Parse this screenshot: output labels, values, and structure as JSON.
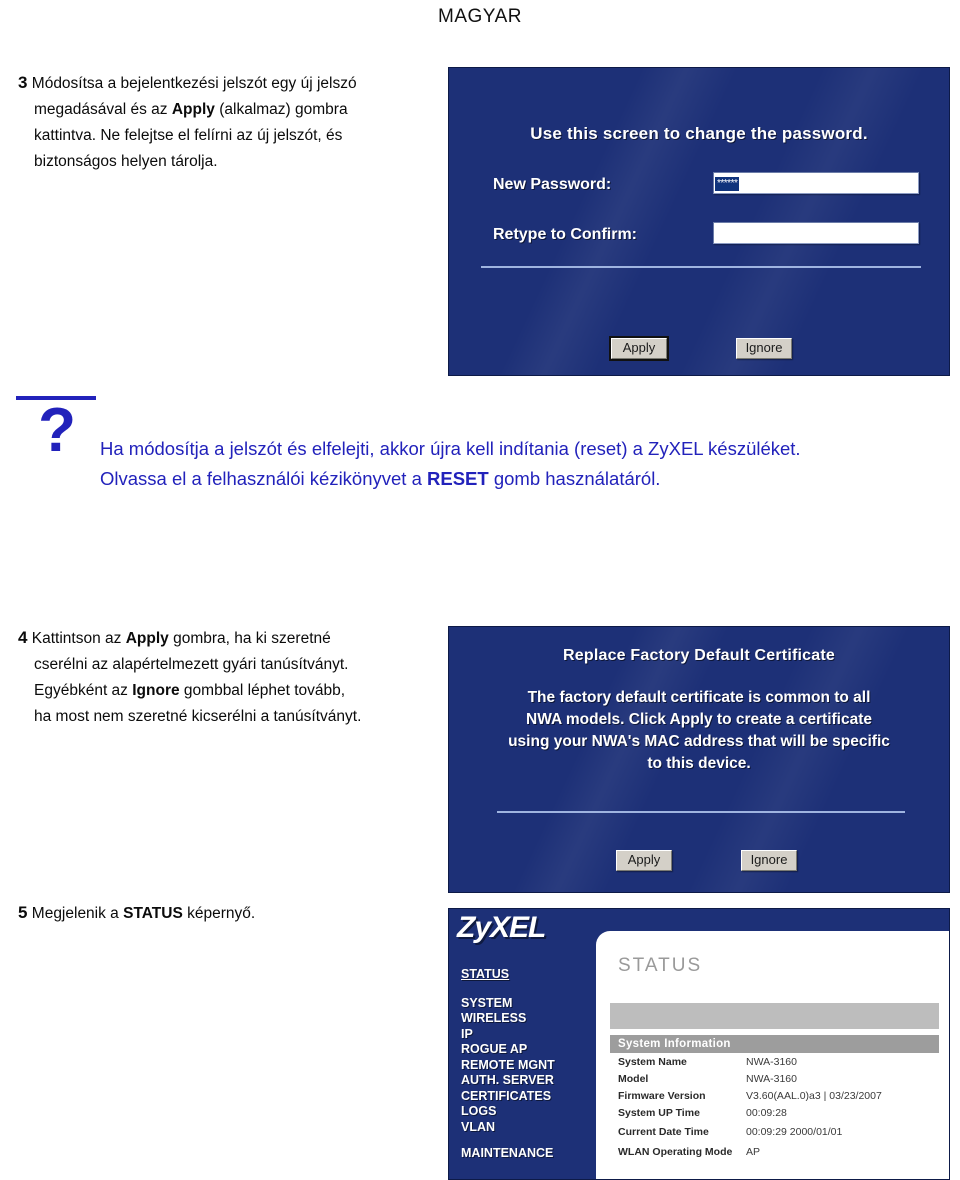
{
  "page": {
    "language_title": "MAGYAR"
  },
  "steps": {
    "step3": {
      "number": "3",
      "line1_a": "Módosítsa a bejelentkezési jelszót egy új jelszó",
      "line2_a": "megadásával és az ",
      "line2_bold": "Apply",
      "line2_b": " (alkalmaz) gombra",
      "line3": "kattintva. Ne felejtse el felírni az új jelszót, és",
      "line4": "biztonságos helyen tárolja."
    },
    "step4": {
      "number": "4",
      "line1_a": "Kattintson az ",
      "line1_bold": "Apply",
      "line1_b": " gombra, ha ki szeretné",
      "line2": "cserélni az alapértelmezett gyári tanúsítványt.",
      "line3_a": "Egyébként az ",
      "line3_bold": "Ignore",
      "line3_b": " gombbal léphet tovább,",
      "line4": "ha most nem szeretné kicserélni a tanúsítványt."
    },
    "step5": {
      "number": "5",
      "line1_a": "Megjelenik a ",
      "line1_bold": "STATUS",
      "line1_b": " képernyő."
    }
  },
  "note": {
    "icon": "question-mark-icon",
    "line1": "Ha módosítja a jelszót és elfelejti, akkor újra kell indítania (reset) a ZyXEL",
    "line2_a": "készüléket. Olvassa el a felhasználói kézikönyvet a ",
    "line2_bold": "RESET",
    "line2_b": " gomb",
    "line3": "használatáról.",
    "color": "#2222bb"
  },
  "screens": {
    "password": {
      "title": "Use this screen to change the password.",
      "fields": [
        {
          "label": "New Password:",
          "value": "******"
        },
        {
          "label": "Retype to Confirm:",
          "value": ""
        }
      ],
      "buttons": [
        {
          "label": "Apply",
          "focused": true
        },
        {
          "label": "Ignore",
          "focused": false
        }
      ],
      "bg_color": "#1d3077"
    },
    "certificate": {
      "title": "Replace Factory Default Certificate",
      "body_line1": "The factory default certificate is common to all",
      "body_line2": "NWA models. Click Apply to create a certificate",
      "body_line3": "using your NWA's MAC address that will be specific",
      "body_line4": "to this device.",
      "buttons": [
        {
          "label": "Apply",
          "focused": false
        },
        {
          "label": "Ignore",
          "focused": false
        }
      ],
      "bg_color": "#1d3077"
    },
    "status": {
      "logo": "ZyXEL",
      "nav": {
        "active_item": "STATUS",
        "items": [
          "SYSTEM",
          "WIRELESS",
          "IP",
          "ROGUE AP",
          "REMOTE MGNT",
          "AUTH. SERVER",
          "CERTIFICATES",
          "LOGS",
          "VLAN"
        ],
        "footer_item": "MAINTENANCE"
      },
      "content_heading": "STATUS",
      "table": {
        "header": "System Information",
        "rows": [
          {
            "key": "System Name",
            "value": "NWA-3160"
          },
          {
            "key": "Model",
            "value": "NWA-3160"
          },
          {
            "key": "Firmware Version",
            "value": "V3.60(AAL.0)a3 | 03/23/2007"
          },
          {
            "key": "System UP Time",
            "value": "00:09:28"
          },
          {
            "key": "Current Date Time",
            "value": "00:09:29  2000/01/01"
          },
          {
            "key": "WLAN Operating Mode",
            "value": "AP"
          }
        ]
      }
    }
  }
}
